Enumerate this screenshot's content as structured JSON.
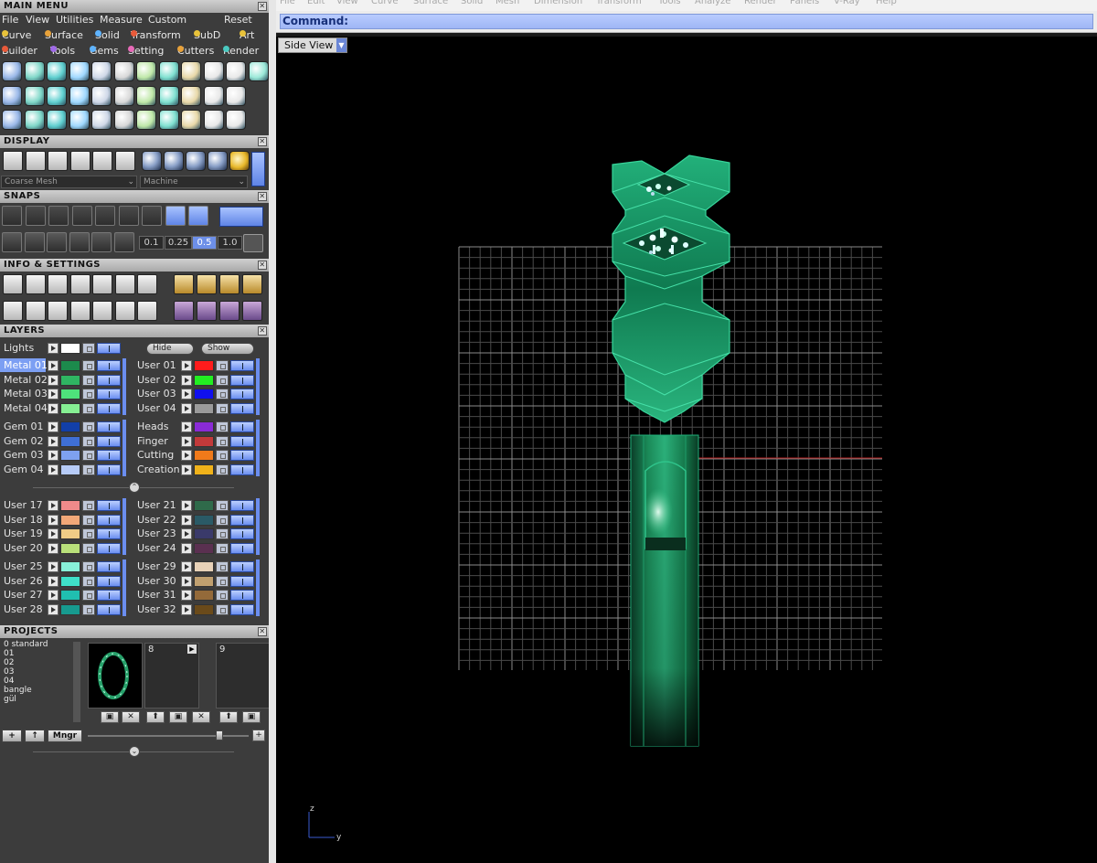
{
  "main_menu": {
    "title": "MAIN MENU",
    "row1": [
      "File",
      "View",
      "Utilities",
      "Measure",
      "Custom",
      "Reset"
    ],
    "row2": [
      {
        "label": "Curve",
        "color": "#e8c23a"
      },
      {
        "label": "Surface",
        "color": "#e8a23a"
      },
      {
        "label": "Solid",
        "color": "#5fb4ff"
      },
      {
        "label": "Transform",
        "color": "#e85a3a"
      },
      {
        "label": "SubD",
        "color": "#e8c23a"
      },
      {
        "label": "Art",
        "color": "#e8c23a"
      }
    ],
    "row3": [
      {
        "label": "Builder",
        "color": "#e85a3a"
      },
      {
        "label": "Tools",
        "color": "#a06ae8"
      },
      {
        "label": "Gems",
        "color": "#5fb4ff"
      },
      {
        "label": "Setting",
        "color": "#e86ab8"
      },
      {
        "label": "Cutters",
        "color": "#e8a23a"
      },
      {
        "label": "Render",
        "color": "#4ac9c0"
      }
    ]
  },
  "display": {
    "title": "DISPLAY",
    "mesh_dropdown": "Coarse Mesh",
    "material_dropdown": "Machine"
  },
  "snaps": {
    "title": "SNAPS",
    "values": [
      "0.1",
      "0.25",
      "0.5",
      "1.0"
    ],
    "selected_value": "0.5"
  },
  "info": {
    "title": "INFO & SETTINGS"
  },
  "layers": {
    "title": "LAYERS",
    "lights_label": "Lights",
    "hide_label": "Hide",
    "show_label": "Show",
    "left_groups": [
      [
        {
          "name": "Metal 01",
          "color": "#1c8a4c",
          "selected": true
        },
        {
          "name": "Metal 02",
          "color": "#2fb562"
        },
        {
          "name": "Metal 03",
          "color": "#4ee27b"
        },
        {
          "name": "Metal 04",
          "color": "#86ef93"
        }
      ],
      [
        {
          "name": "Gem 01",
          "color": "#123fa8"
        },
        {
          "name": "Gem 02",
          "color": "#3f6fd6"
        },
        {
          "name": "Gem 03",
          "color": "#7ea1f0"
        },
        {
          "name": "Gem 04",
          "color": "#b6cbf7"
        }
      ],
      [
        {
          "name": "User 17",
          "color": "#f08a8a"
        },
        {
          "name": "User 18",
          "color": "#f2a878"
        },
        {
          "name": "User 19",
          "color": "#f0cc86"
        },
        {
          "name": "User 20",
          "color": "#b9e07a"
        }
      ],
      [
        {
          "name": "User 25",
          "color": "#88f0d8"
        },
        {
          "name": "User 26",
          "color": "#3fe0c8"
        },
        {
          "name": "User 27",
          "color": "#20bfb0"
        },
        {
          "name": "User 28",
          "color": "#179a8f"
        }
      ]
    ],
    "right_groups": [
      [
        {
          "name": "User 01",
          "color": "#ff1c1c"
        },
        {
          "name": "User 02",
          "color": "#22ee22"
        },
        {
          "name": "User 03",
          "color": "#1010ee"
        },
        {
          "name": "User 04",
          "color": "#9a9a9a"
        }
      ],
      [
        {
          "name": "Heads",
          "color": "#8a2bd6"
        },
        {
          "name": "Finger",
          "color": "#c23a3a"
        },
        {
          "name": "Cutting",
          "color": "#f07a1a"
        },
        {
          "name": "Creation",
          "color": "#f0b21a"
        }
      ],
      [
        {
          "name": "User 21",
          "color": "#2f6a4a"
        },
        {
          "name": "User 22",
          "color": "#2a5a66"
        },
        {
          "name": "User 23",
          "color": "#3a3a6a"
        },
        {
          "name": "User 24",
          "color": "#5a3050"
        }
      ],
      [
        {
          "name": "User 29",
          "color": "#e8d2b8"
        },
        {
          "name": "User 30",
          "color": "#c0a070"
        },
        {
          "name": "User 31",
          "color": "#946a3a"
        },
        {
          "name": "User 32",
          "color": "#6a4a1a"
        }
      ]
    ]
  },
  "projects": {
    "title": "PROJECTS",
    "list": [
      "0 standard",
      "01",
      "02",
      "03",
      "04",
      "bangle",
      "gül"
    ],
    "slots": [
      "8",
      "9"
    ],
    "manager_label": "Mngr",
    "plus_label": "+",
    "up_label": "↑"
  },
  "top_menu": [
    "File",
    "Edit",
    "View",
    "Curve",
    "Surface",
    "Solid",
    "Mesh",
    "Dimension",
    "Transform",
    "Tools",
    "Analyze",
    "Render",
    "Panels",
    "V-Ray",
    "Help"
  ],
  "command": {
    "label": "Command:"
  },
  "viewport": {
    "view_name": "Side View",
    "axis_z": "z",
    "axis_y": "y"
  }
}
